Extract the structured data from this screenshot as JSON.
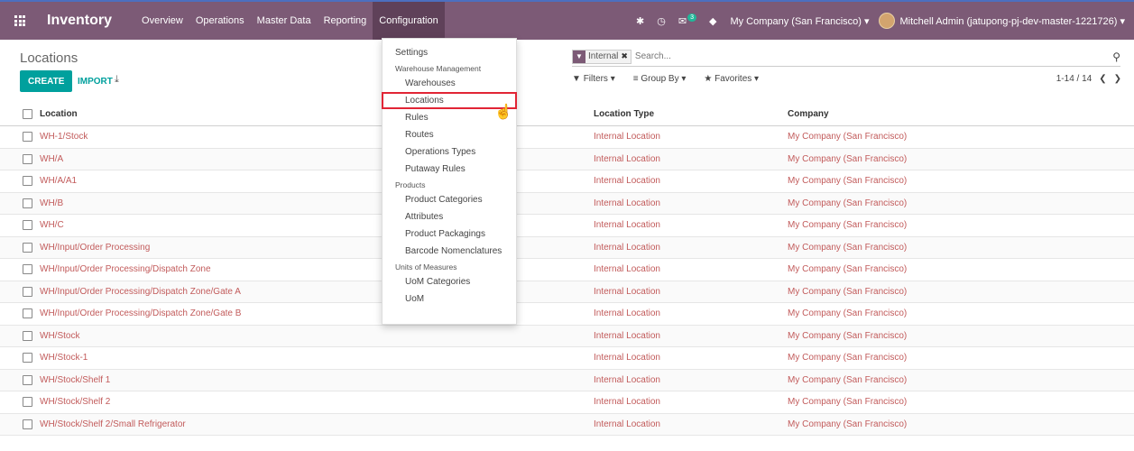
{
  "navbar": {
    "brand": "Inventory",
    "menu": [
      "Overview",
      "Operations",
      "Master Data",
      "Reporting",
      "Configuration"
    ],
    "active": "Configuration",
    "messages_count": "3",
    "company": "My Company (San Francisco) ▾",
    "user": "Mitchell Admin (jatupong-pj-dev-master-1221726) ▾"
  },
  "control": {
    "breadcrumb": "Locations",
    "create_label": "CREATE",
    "import_label": "IMPORT",
    "facet_value": "Internal",
    "search_placeholder": "Search...",
    "filters_label": "Filters ▾",
    "groupby_label": "Group By ▾",
    "favorites_label": "Favorites ▾",
    "pager": "1-14 / 14"
  },
  "table": {
    "headers": {
      "location": "Location",
      "type": "Location Type",
      "company": "Company"
    },
    "rows": [
      {
        "location": "WH-1/Stock",
        "type": "Internal Location",
        "company": "My Company (San Francisco)"
      },
      {
        "location": "WH/A",
        "type": "Internal Location",
        "company": "My Company (San Francisco)"
      },
      {
        "location": "WH/A/A1",
        "type": "Internal Location",
        "company": "My Company (San Francisco)"
      },
      {
        "location": "WH/B",
        "type": "Internal Location",
        "company": "My Company (San Francisco)"
      },
      {
        "location": "WH/C",
        "type": "Internal Location",
        "company": "My Company (San Francisco)"
      },
      {
        "location": "WH/Input/Order Processing",
        "type": "Internal Location",
        "company": "My Company (San Francisco)"
      },
      {
        "location": "WH/Input/Order Processing/Dispatch Zone",
        "type": "Internal Location",
        "company": "My Company (San Francisco)"
      },
      {
        "location": "WH/Input/Order Processing/Dispatch Zone/Gate A",
        "type": "Internal Location",
        "company": "My Company (San Francisco)"
      },
      {
        "location": "WH/Input/Order Processing/Dispatch Zone/Gate B",
        "type": "Internal Location",
        "company": "My Company (San Francisco)"
      },
      {
        "location": "WH/Stock",
        "type": "Internal Location",
        "company": "My Company (San Francisco)"
      },
      {
        "location": "WH/Stock-1",
        "type": "Internal Location",
        "company": "My Company (San Francisco)"
      },
      {
        "location": "WH/Stock/Shelf 1",
        "type": "Internal Location",
        "company": "My Company (San Francisco)"
      },
      {
        "location": "WH/Stock/Shelf 2",
        "type": "Internal Location",
        "company": "My Company (San Francisco)"
      },
      {
        "location": "WH/Stock/Shelf 2/Small Refrigerator",
        "type": "Internal Location",
        "company": "My Company (San Francisco)"
      }
    ]
  },
  "dropdown": {
    "settings": "Settings",
    "warehouse_header": "Warehouse Management",
    "warehouse_items": [
      "Warehouses",
      "Locations",
      "Rules",
      "Routes",
      "Operations Types",
      "Putaway Rules"
    ],
    "products_header": "Products",
    "products_items": [
      "Product Categories",
      "Attributes",
      "Product Packagings",
      "Barcode Nomenclatures"
    ],
    "uom_header": "Units of Measures",
    "uom_items": [
      "UoM Categories",
      "UoM"
    ],
    "selected": "Locations"
  },
  "colors": {
    "navbar": "#7c5a76",
    "accent": "#00a09d",
    "link": "#c25b5b",
    "highlight": "#e12535"
  }
}
